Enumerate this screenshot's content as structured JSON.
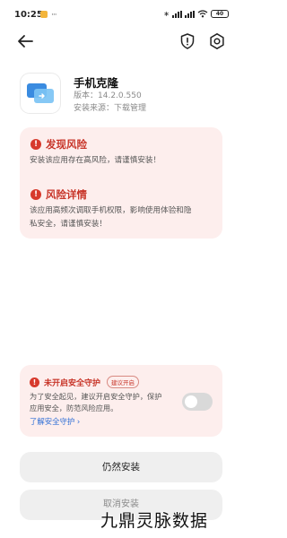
{
  "status_bar": {
    "time": "10:25",
    "notif_glyph": "···",
    "icons": [
      "bluetooth-icon",
      "signal-icon",
      "signal-icon",
      "wifi-icon"
    ],
    "bluetooth_glyph": "∗",
    "battery": "40"
  },
  "nav": {
    "back_icon": "back-arrow-icon",
    "shield_icon": "shield-alert-icon",
    "settings_icon": "gear-icon"
  },
  "app": {
    "name": "手机克隆",
    "version": "版本：14.2.0.550",
    "source": "安装来源：下载管理"
  },
  "risk_found": {
    "title": "发现风险",
    "alert_glyph": "!",
    "description": "安装该应用存在高风险，请谨慎安装！"
  },
  "risk_detail": {
    "title": "风险详情",
    "alert_glyph": "!",
    "description_line1": "该应用高频次调取手机权限，影响使用体验和隐",
    "description_line2": "私安全，请谨慎安装！"
  },
  "protection": {
    "alert_glyph": "!",
    "title": "未开启安全守护",
    "badge": "建议开启",
    "description_line1": "为了安全起见，建议开启安全守护，保护",
    "description_line2": "应用安全，防范风险应用。",
    "link": "了解安全守护 ›",
    "toggle_on": false
  },
  "buttons": {
    "install": "仍然安装",
    "cancel": "取消安装"
  },
  "watermark": "九鼎灵脉数据",
  "colors": {
    "risk_red": "#c8362a",
    "card_bg": "#fdeeed",
    "link_blue": "#2f6fd6",
    "button_bg": "#efefef"
  }
}
